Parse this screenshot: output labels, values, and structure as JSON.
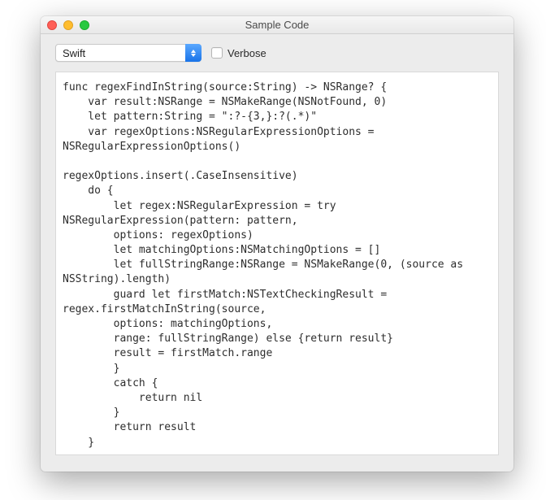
{
  "window": {
    "title": "Sample Code"
  },
  "toolbar": {
    "language_selected": "Swift",
    "verbose_label": "Verbose",
    "verbose_checked": false
  },
  "code": "func regexFindInString(source:String) -> NSRange? {\n    var result:NSRange = NSMakeRange(NSNotFound, 0)\n    let pattern:String = \":?-{3,}:?(.*)\"\n    var regexOptions:NSRegularExpressionOptions =\nNSRegularExpressionOptions()\n\nregexOptions.insert(.CaseInsensitive)\n    do {\n        let regex:NSRegularExpression = try\nNSRegularExpression(pattern: pattern,\n        options: regexOptions)\n        let matchingOptions:NSMatchingOptions = []\n        let fullStringRange:NSRange = NSMakeRange(0, (source as\nNSString).length)\n        guard let firstMatch:NSTextCheckingResult =\nregex.firstMatchInString(source,\n        options: matchingOptions,\n        range: fullStringRange) else {return result}\n        result = firstMatch.range\n        }\n        catch {\n            return nil\n        }\n        return result\n    }"
}
